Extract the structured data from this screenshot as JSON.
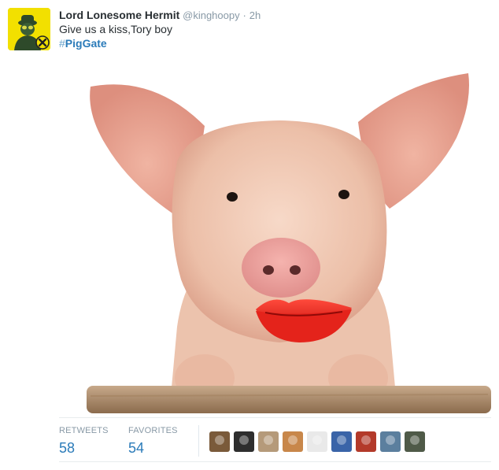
{
  "tweet": {
    "author_name": "Lord Lonesome Hermit",
    "handle": "@kinghoopy",
    "separator": "·",
    "time": "2h",
    "text": "Give us a kiss,Tory boy",
    "hashtag_symbol": "#",
    "hashtag_word": "PigGate",
    "media_description": "pig with red lips"
  },
  "stats": {
    "retweets_label": "RETWEETS",
    "retweets_value": "58",
    "favorites_label": "FAVORITES",
    "favorites_value": "54"
  },
  "favoriters": [
    {
      "name": "favoriter-1",
      "color": "#7a5a3a"
    },
    {
      "name": "favoriter-2",
      "color": "#2e2e2e"
    },
    {
      "name": "favoriter-3",
      "color": "#b59a7a"
    },
    {
      "name": "favoriter-4",
      "color": "#c8874a"
    },
    {
      "name": "favoriter-5",
      "color": "#e9e9e9"
    },
    {
      "name": "favoriter-6",
      "color": "#3a64a8"
    },
    {
      "name": "favoriter-7",
      "color": "#b33a2a"
    },
    {
      "name": "favoriter-8",
      "color": "#5b7f9e"
    },
    {
      "name": "favoriter-9",
      "color": "#4f5a48"
    }
  ],
  "colors": {
    "name": "#292f33",
    "meta": "#8899a6",
    "link": "#2b7bb9",
    "avatar_bg": "#f2e000"
  }
}
